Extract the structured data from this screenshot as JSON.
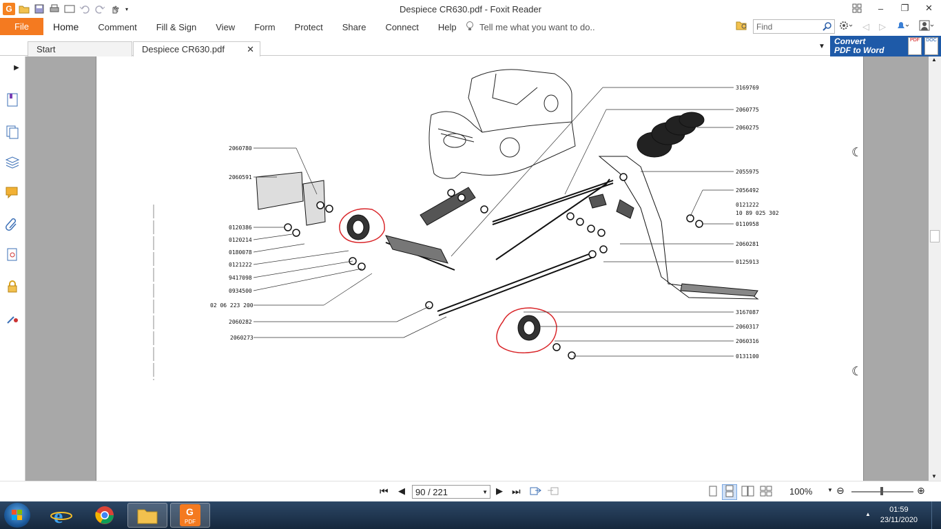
{
  "window": {
    "title": "Despiece CR630.pdf - Foxit Reader",
    "app_logo": "G"
  },
  "menu": {
    "file": "File",
    "items": [
      "Home",
      "Comment",
      "Fill & Sign",
      "View",
      "Form",
      "Protect",
      "Share",
      "Connect",
      "Help"
    ],
    "tell_me": "Tell me what you want to do..",
    "find_placeholder": "Find"
  },
  "tabs": {
    "start": "Start",
    "active": "Despiece CR630.pdf"
  },
  "convert": {
    "line1": "Convert",
    "line2": "PDF to Word",
    "pdf_badge": "PDF",
    "doc_badge": "DOC"
  },
  "diagram": {
    "part_numbers_left": [
      "2060780",
      "2060591",
      "0120386",
      "0120214",
      "0180078",
      "0121222",
      "9417098",
      "0934500",
      "02 06 223 200",
      "2060282",
      "2060273"
    ],
    "part_numbers_right": [
      "3169769",
      "2060775",
      "2060275",
      "2055975",
      "2056492",
      "0121222",
      "10 89 025 302",
      "0110958",
      "2060281",
      "0125913",
      "3167087",
      "2060317",
      "2060316",
      "0131100"
    ]
  },
  "status": {
    "page": "90 / 221",
    "zoom": "100%"
  },
  "taskbar": {
    "time": "01:59",
    "date": "23/11/2020",
    "pdf_label": "PDF"
  },
  "colors": {
    "accent": "#f47a20",
    "convert_bg": "#1e5aa8",
    "highlight": "#d9262a"
  }
}
